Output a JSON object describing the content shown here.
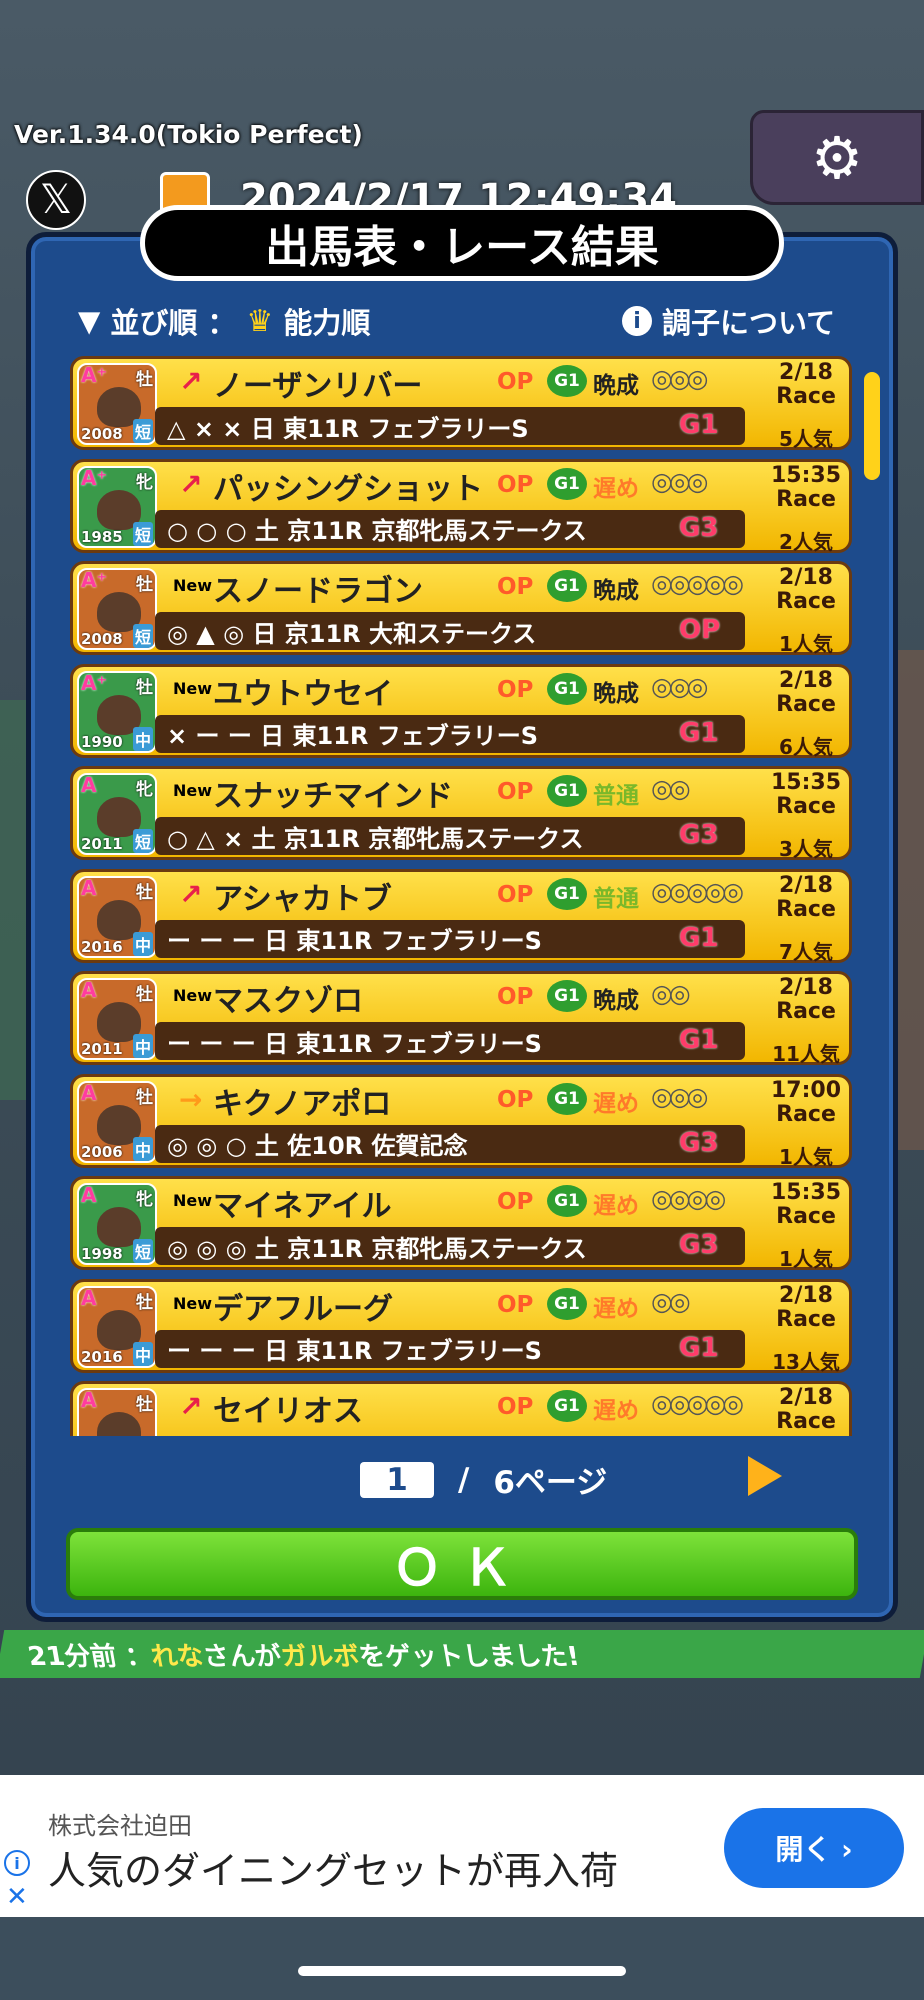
{
  "version": "Ver.1.34.0(Tokio Perfect)",
  "datetime": "2024/2/17 12:49:34",
  "dialog_title": "出馬表・レース結果",
  "sort_label": "並び順 ： ",
  "sort_value": "能力順",
  "condition_link": "調子について",
  "horses": [
    {
      "rank": "A⁺",
      "sex": "牡",
      "year": "2008",
      "dist": "短",
      "trend": "↗",
      "name": "ノーザンリバー",
      "cls": "OP",
      "g": "G1",
      "growth": "晩成",
      "dots": "◎◎◎",
      "marks": "△ × × 日 東11R フェブラリーS",
      "grade": "G1",
      "when": "2/18\nRace",
      "pop": "5人気",
      "avbg": "#c86a2a"
    },
    {
      "rank": "A⁺",
      "sex": "牝",
      "year": "1985",
      "dist": "短",
      "trend": "↗",
      "name": "パッシングショット",
      "cls": "OP",
      "g": "G1",
      "growth": "遅め",
      "dots": "◎◎◎",
      "marks": "○ ○ ○ 土 京11R 京都牝馬ステークス",
      "grade": "G3",
      "when": "15:35\nRace",
      "pop": "2人気",
      "avbg": "#3a9a4a"
    },
    {
      "rank": "A⁺",
      "sex": "牡",
      "year": "2008",
      "dist": "短",
      "trend": "New",
      "name": "スノードラゴン",
      "cls": "OP",
      "g": "G1",
      "growth": "晩成",
      "dots": "◎◎◎◎◎",
      "marks": "◎ ▲ ◎ 日 京11R 大和ステークス",
      "grade": "OP",
      "when": "2/18\nRace",
      "pop": "1人気",
      "avbg": "#c86a2a"
    },
    {
      "rank": "A⁺",
      "sex": "牡",
      "year": "1990",
      "dist": "中",
      "trend": "New",
      "name": "ユウトウセイ",
      "cls": "OP",
      "g": "G1",
      "growth": "晩成",
      "dots": "◎◎◎",
      "marks": "× ー ー 日 東11R フェブラリーS",
      "grade": "G1",
      "when": "2/18\nRace",
      "pop": "6人気",
      "avbg": "#3a9a4a"
    },
    {
      "rank": "A",
      "sex": "牝",
      "year": "2011",
      "dist": "短",
      "trend": "New",
      "name": "スナッチマインド",
      "cls": "OP",
      "g": "G1",
      "growth": "普通",
      "dots": "◎◎",
      "marks": "○ △ × 土 京11R 京都牝馬ステークス",
      "grade": "G3",
      "when": "15:35\nRace",
      "pop": "3人気",
      "avbg": "#3a9a4a"
    },
    {
      "rank": "A",
      "sex": "牡",
      "year": "2016",
      "dist": "中",
      "trend": "↗",
      "name": "アシャカトブ",
      "cls": "OP",
      "g": "G1",
      "growth": "普通",
      "dots": "◎◎◎◎◎",
      "marks": "ー ー ー 日 東11R フェブラリーS",
      "grade": "G1",
      "when": "2/18\nRace",
      "pop": "7人気",
      "avbg": "#c86a2a"
    },
    {
      "rank": "A",
      "sex": "牡",
      "year": "2011",
      "dist": "中",
      "trend": "New",
      "name": "マスクゾロ",
      "cls": "OP",
      "g": "G1",
      "growth": "晩成",
      "dots": "◎◎",
      "marks": "ー ー ー 日 東11R フェブラリーS",
      "grade": "G1",
      "when": "2/18\nRace",
      "pop": "11人気",
      "avbg": "#c86a2a"
    },
    {
      "rank": "A",
      "sex": "牡",
      "year": "2006",
      "dist": "中",
      "trend": "→",
      "name": "キクノアポロ",
      "cls": "OP",
      "g": "G1",
      "growth": "遅め",
      "dots": "◎◎◎",
      "marks": "◎ ◎ ○ 土 佐10R 佐賀記念",
      "grade": "G3",
      "when": "17:00\nRace",
      "pop": "1人気",
      "avbg": "#c86a2a"
    },
    {
      "rank": "A",
      "sex": "牝",
      "year": "1998",
      "dist": "短",
      "trend": "New",
      "name": "マイネアイル",
      "cls": "OP",
      "g": "G1",
      "growth": "遅め",
      "dots": "◎◎◎◎",
      "marks": "◎ ◎ ◎ 土 京11R 京都牝馬ステークス",
      "grade": "G3",
      "when": "15:35\nRace",
      "pop": "1人気",
      "avbg": "#3a9a4a"
    },
    {
      "rank": "A",
      "sex": "牡",
      "year": "2016",
      "dist": "中",
      "trend": "New",
      "name": "デアフルーグ",
      "cls": "OP",
      "g": "G1",
      "growth": "遅め",
      "dots": "◎◎",
      "marks": "ー ー ー 日 東11R フェブラリーS",
      "grade": "G1",
      "when": "2/18\nRace",
      "pop": "13人気",
      "avbg": "#c86a2a"
    },
    {
      "rank": "A",
      "sex": "牡",
      "year": "",
      "dist": "",
      "trend": "↗",
      "name": "セイリオス",
      "cls": "OP",
      "g": "G1",
      "growth": "遅め",
      "dots": "◎◎◎◎◎",
      "marks": "",
      "grade": "",
      "when": "2/18\nRace",
      "pop": "",
      "avbg": "#c86a2a"
    }
  ],
  "pager": {
    "current": "1",
    "separator": "/",
    "total": "6ページ"
  },
  "ok_label": "ＯＫ",
  "ticker": {
    "time": "21分前 ： ",
    "user": "れな",
    "mid": "さんが",
    "item": "ガルボ",
    "end": "をゲットしました!"
  },
  "ad": {
    "company": "株式会社迫田",
    "title": "人気のダイニングセットが再入荷",
    "button": "開く ›"
  },
  "colors": {
    "panel": "#1d4b8c",
    "row": "#ffd21a",
    "ok": "#4cc81a",
    "ticker": "#3aa648",
    "ad_button": "#1a73e8"
  }
}
